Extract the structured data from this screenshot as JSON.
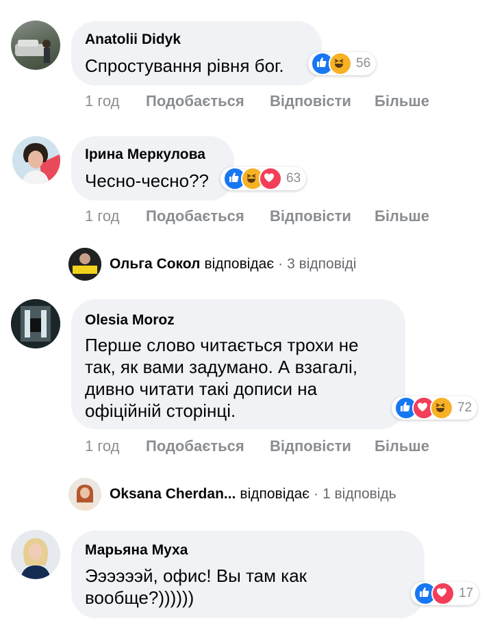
{
  "comments": [
    {
      "author": "Anatolii Didyk",
      "text": "Спростування рівня бог.",
      "reactions": [
        "like-icon",
        "haha-icon"
      ],
      "reaction_count": "56",
      "time": "1 год",
      "like": "Подобається",
      "reply": "Відповісти",
      "more": "Більше"
    },
    {
      "author": "Ірина Меркулова",
      "text": "Чесно-чесно??",
      "reactions": [
        "like-icon",
        "haha-icon",
        "love-icon"
      ],
      "reaction_count": "63",
      "time": "1 год",
      "like": "Подобається",
      "reply": "Відповісти",
      "more": "Більше",
      "replies": {
        "author": "Ольга Сокол",
        "verb": "відповідає",
        "sep": "·",
        "count": "3 відповіді"
      }
    },
    {
      "author": "Olesia Moroz",
      "text_lines": [
        "Перше слово читається трохи не",
        "так, як вами задумано. А взагалі,",
        "дивно читати такі дописи на",
        "офіційній сторінці."
      ],
      "reactions": [
        "like-icon",
        "love-icon",
        "haha-icon"
      ],
      "reaction_count": "72",
      "time": "1 год",
      "like": "Подобається",
      "reply": "Відповісти",
      "more": "Більше",
      "replies": {
        "author": "Oksana Cherdan...",
        "verb": "відповідає",
        "sep": "·",
        "count": "1 відповідь"
      }
    },
    {
      "author": "Марьяна Муха",
      "text_lines": [
        "Ээээээй, офис! Вы там как",
        "вообще?))))))"
      ],
      "reactions": [
        "like-icon",
        "love-icon"
      ],
      "reaction_count": "17"
    }
  ],
  "colors": {
    "like": "#1877f2",
    "love": "#f33e58",
    "haha": "#f7b125",
    "bubble": "#f0f2f5",
    "meta": "#8a8d91"
  }
}
